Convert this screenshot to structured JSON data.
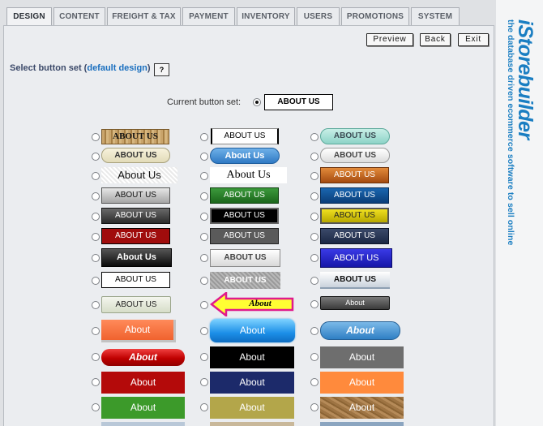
{
  "tabs": [
    {
      "label": "DESIGN",
      "active": true
    },
    {
      "label": "CONTENT",
      "active": false
    },
    {
      "label": "FREIGHT & TAX",
      "active": false
    },
    {
      "label": "PAYMENT",
      "active": false
    },
    {
      "label": "INVENTORY",
      "active": false
    },
    {
      "label": "USERS",
      "active": false
    },
    {
      "label": "PROMOTIONS",
      "active": false
    },
    {
      "label": "SYSTEM",
      "active": false
    }
  ],
  "toolbar": {
    "preview_label": "Preview",
    "back_label": "Back",
    "exit_label": "Exit"
  },
  "heading": {
    "prefix": "Select button set (",
    "link": "default design",
    "suffix": ")",
    "help": "?"
  },
  "current": {
    "label": "Current button set:",
    "button_text": "ABOUT US"
  },
  "brand": {
    "name": "iStorebuilder",
    "tagline": "the database driven ecommerce software to sell online"
  },
  "button_sets": [
    [
      "ABOUT US",
      "ABOUT US",
      "ABOUT US"
    ],
    [
      "ABOUT US",
      "About Us",
      "ABOUT US"
    ],
    [
      "About Us",
      "About Us",
      "ABOUT US"
    ],
    [
      "ABOUT US",
      "ABOUT US",
      "ABOUT US"
    ],
    [
      "ABOUT US",
      "ABOUT US",
      "ABOUT US"
    ],
    [
      "ABOUT US",
      "ABOUT US",
      "ABOUT US"
    ],
    [
      "About Us",
      "ABOUT US",
      "ABOUT US"
    ],
    [
      "ABOUT US",
      "ABOUT US",
      "ABOUT US"
    ],
    [
      "ABOUT US",
      "About",
      "About"
    ],
    [
      "About",
      "About",
      "About"
    ],
    [
      "About",
      "About",
      "About"
    ],
    [
      "About",
      "About",
      "About"
    ],
    [
      "About",
      "About",
      "About"
    ]
  ]
}
